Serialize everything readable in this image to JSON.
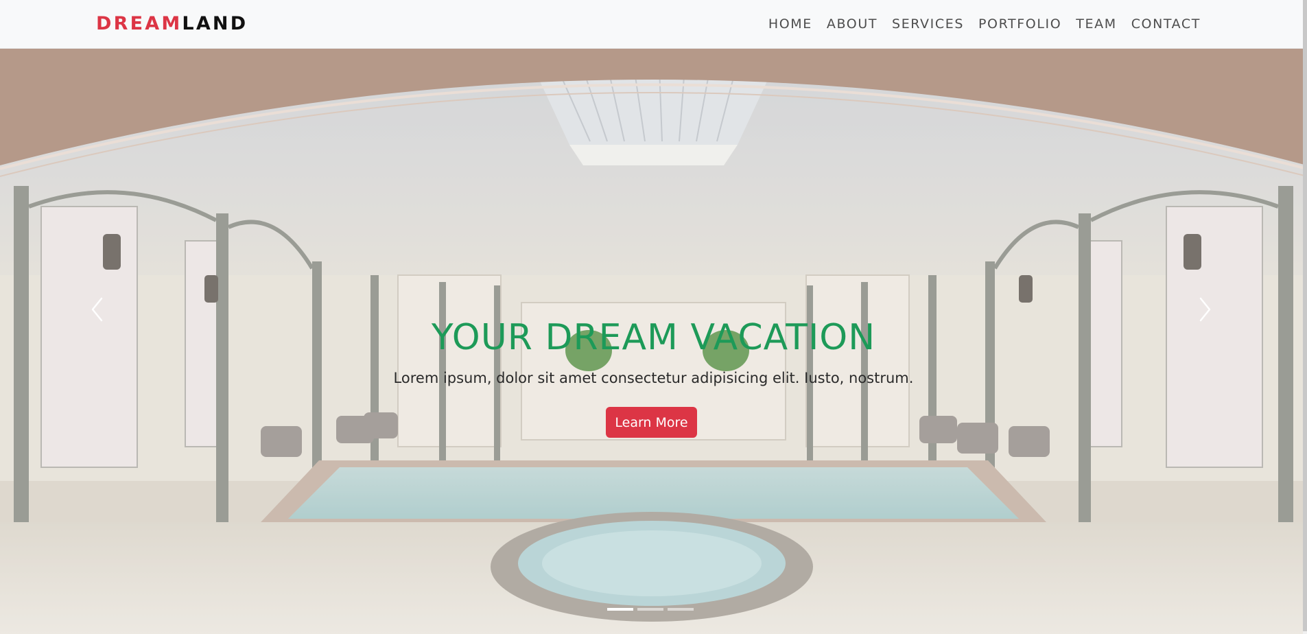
{
  "brand": {
    "part1": "DREAM",
    "part2": "LAND"
  },
  "nav": {
    "items": [
      {
        "label": "HOME"
      },
      {
        "label": "ABOUT"
      },
      {
        "label": "SERVICES"
      },
      {
        "label": "PORTFOLIO"
      },
      {
        "label": "TEAM"
      },
      {
        "label": "CONTACT"
      }
    ]
  },
  "hero": {
    "title": "YOUR DREAM VACATION",
    "subtitle": "Lorem ipsum, dolor sit amet consectetur adipisicing elit. Iusto, nostrum.",
    "button_label": "Learn More",
    "prev_icon": "chevron-left-icon",
    "next_icon": "chevron-right-icon",
    "indicator_count": 3,
    "active_indicator": 1
  },
  "colors": {
    "brand_accent": "#dc3545",
    "title_green": "#1d9a58",
    "navbar_bg": "#f8f9fa"
  }
}
